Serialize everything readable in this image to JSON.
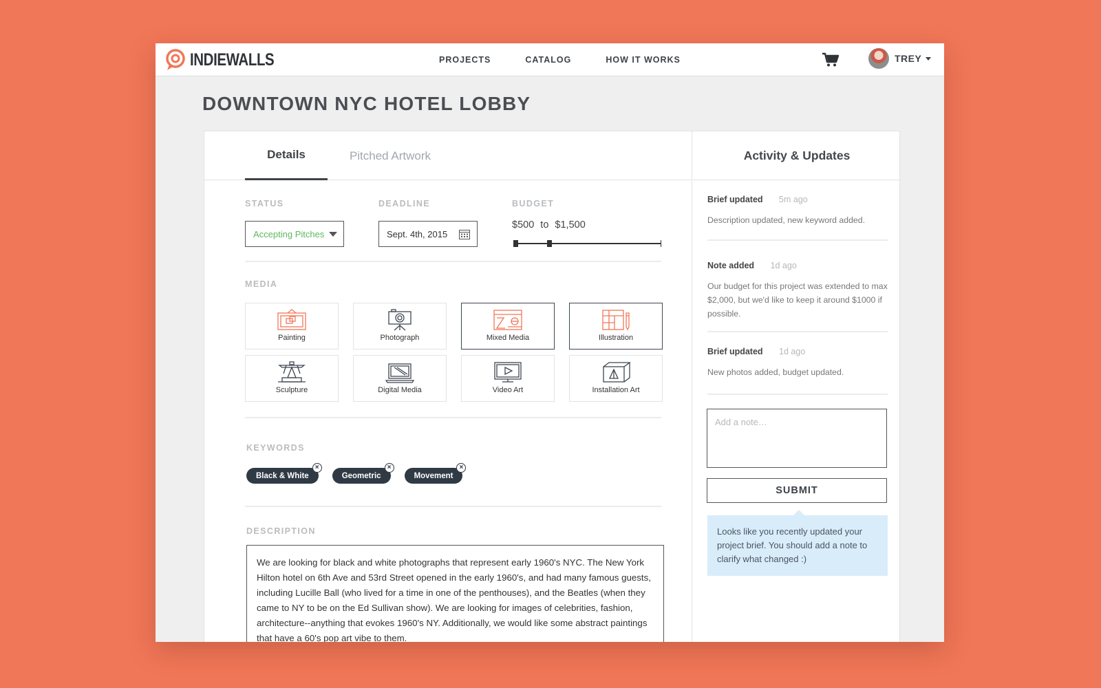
{
  "brand": {
    "name": "INDIEWALLS",
    "accent": "#f07758"
  },
  "nav": {
    "links": [
      "PROJECTS",
      "CATALOG",
      "HOW IT WORKS"
    ],
    "cart_icon": "shopping-cart-icon",
    "user_name": "TREY"
  },
  "project": {
    "title": "DOWNTOWN NYC HOTEL LOBBY"
  },
  "tabs": [
    {
      "label": "Details",
      "active": true
    },
    {
      "label": "Pitched Artwork",
      "active": false
    }
  ],
  "status": {
    "label": "STATUS",
    "value": "Accepting Pitches",
    "color": "#5cb85c"
  },
  "deadline": {
    "label": "DEADLINE",
    "value": "Sept. 4th, 2015"
  },
  "budget": {
    "label": "BUDGET",
    "min": "$500",
    "separator": "to",
    "max": "$1,500",
    "range_low_fraction": 0.0,
    "range_high_fraction": 0.23
  },
  "media": {
    "label": "MEDIA",
    "items": [
      {
        "label": "Painting",
        "icon": "painting-icon",
        "selected": true
      },
      {
        "label": "Photograph",
        "icon": "camera-icon",
        "selected": false
      },
      {
        "label": "Mixed Media",
        "icon": "mixed-media-icon",
        "selected": true
      },
      {
        "label": "Illustration",
        "icon": "illustration-icon",
        "selected": true
      },
      {
        "label": "Sculpture",
        "icon": "sculpture-icon",
        "selected": false
      },
      {
        "label": "Digital Media",
        "icon": "laptop-icon",
        "selected": false
      },
      {
        "label": "Video Art",
        "icon": "video-icon",
        "selected": false
      },
      {
        "label": "Installation Art",
        "icon": "installation-icon",
        "selected": false
      }
    ]
  },
  "keywords": {
    "label": "KEYWORDS",
    "items": [
      "Black & White",
      "Geometric",
      "Movement"
    ]
  },
  "description": {
    "label": "DESCRIPTION",
    "text": "We are looking for black and white photographs that represent early 1960's NYC. The New York Hilton hotel on 6th Ave and 53rd Street opened in the early 1960's, and had many famous guests, including Lucille Ball (who lived for a time in one of the penthouses), and the Beatles (when they came to NY to be on the Ed Sullivan show). We are looking for images of celebrities, fashion, architecture--anything that evokes 1960's NY. Additionally, we would like some abstract paintings that have a 60's pop art vibe to them."
  },
  "activity": {
    "title": "Activity & Updates",
    "items": [
      {
        "kind": "Brief updated",
        "time": "5m ago",
        "body": "Description updated, new keyword added."
      },
      {
        "kind": "Note added",
        "time": "1d ago",
        "body": "Our budget for this project was extended to max $2,000, but we'd like to keep it around $1000 if possible."
      },
      {
        "kind": "Brief updated",
        "time": "1d ago",
        "body": "New photos added, budget updated."
      }
    ],
    "note_placeholder": "Add a note…",
    "submit_label": "SUBMIT",
    "tip": "Looks like you recently updated your project brief. You should add a note to clarify what changed :)"
  }
}
